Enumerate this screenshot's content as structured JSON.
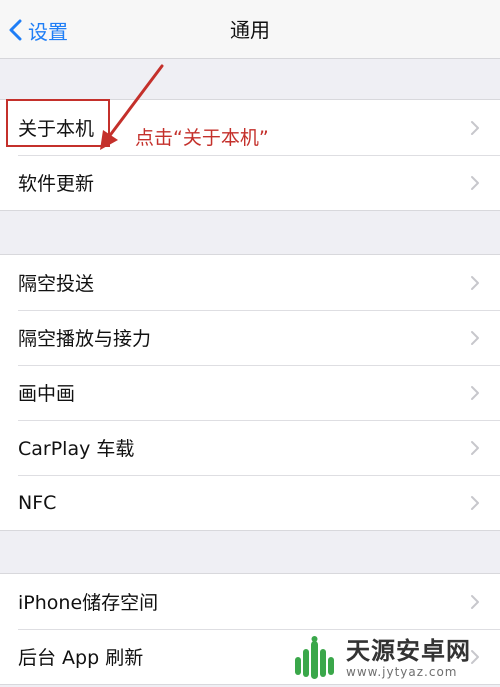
{
  "nav": {
    "back_label": "设置",
    "title": "通用"
  },
  "groups": [
    {
      "items": [
        {
          "label": "关于本机"
        },
        {
          "label": "软件更新"
        }
      ]
    },
    {
      "items": [
        {
          "label": "隔空投送"
        },
        {
          "label": "隔空播放与接力"
        },
        {
          "label": "画中画"
        },
        {
          "label": "CarPlay 车载"
        },
        {
          "label": "NFC"
        }
      ]
    },
    {
      "items": [
        {
          "label": "iPhone储存空间"
        },
        {
          "label": "后台 App 刷新"
        }
      ]
    }
  ],
  "annotation": {
    "text": "点击“关于本机”",
    "color": "#c4302b"
  },
  "watermark": {
    "brand": "天源安卓网",
    "url": "www.jytyaz.com",
    "logo_color": "#3aa74a"
  },
  "colors": {
    "accent": "#1f7ef6",
    "background": "#efeff4",
    "chevron": "#c7c7cc"
  }
}
